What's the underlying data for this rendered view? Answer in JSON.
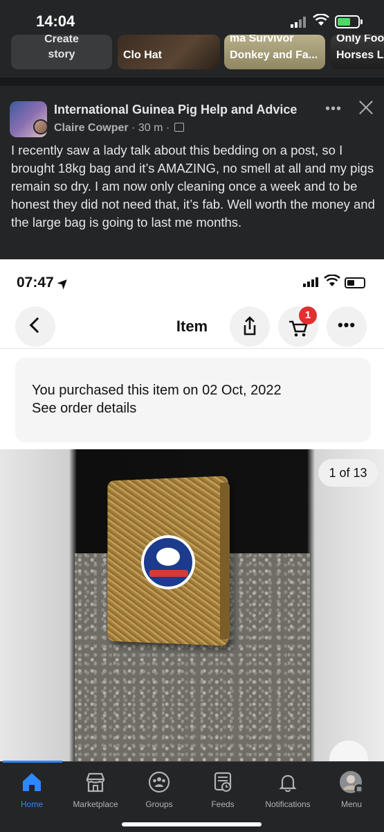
{
  "status_bar": {
    "time": "14:04"
  },
  "stories": [
    {
      "caption_lines": [
        "Create",
        "story"
      ]
    },
    {
      "caption_lines": [
        "",
        "Clo Hat"
      ]
    },
    {
      "caption_lines": [
        "ma Survivor",
        "Donkey and Fa..."
      ]
    },
    {
      "caption_lines": [
        "Only Foo",
        "Horses L"
      ]
    }
  ],
  "post": {
    "group_name": "International Guinea Pig Help and Advice",
    "author": "Claire Cowper",
    "time": "30 m",
    "separator": "·",
    "more_label": "•••",
    "text": "I recently saw a lady talk about this bedding on a post, so I brought 18kg bag and it’s AMAZING, no smell at all and my pigs remain so dry. I am now only cleaning once a week and to be honest they did not need that, it’s fab. Well worth the money and the large bag is going to last me months."
  },
  "attachment": {
    "time": "07:47",
    "location_arrow": "➤",
    "title": "Item",
    "cart_badge": "1",
    "more_label": "•••",
    "purchase_line1": "You purchased this item on 02 Oct, 2022",
    "purchase_line2": "See order details",
    "image_counter": "1 of 13"
  },
  "tabbar": {
    "tabs": [
      {
        "label": "Home",
        "icon": "home-icon",
        "active": true
      },
      {
        "label": "Marketplace",
        "icon": "marketplace-icon",
        "active": false
      },
      {
        "label": "Groups",
        "icon": "groups-icon",
        "active": false
      },
      {
        "label": "Feeds",
        "icon": "feeds-icon",
        "active": false
      },
      {
        "label": "Notifications",
        "icon": "bell-icon",
        "active": false
      },
      {
        "label": "Menu",
        "icon": "avatar",
        "active": false
      }
    ],
    "active_color": "#2d88ff"
  }
}
